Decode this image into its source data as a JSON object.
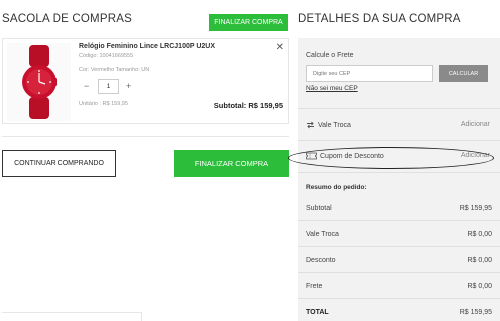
{
  "cart": {
    "title": "SACOLA DE COMPRAS",
    "finalize_top": "FINALIZAR COMPRA",
    "item": {
      "name": "Relógio Feminino Lince LRCJ100P U2UX",
      "code": "Código: 10041669555",
      "variant": "Cor: Vermelho Tamanho: UN",
      "quantity": "1",
      "unit_price": "Unitário : R$ 159,95",
      "subtotal": "Subtotal: R$ 159,95",
      "image_icon": "red-wristwatch"
    },
    "continue_label": "CONTINUAR COMPRANDO",
    "finalize_bottom": "FINALIZAR COMPRA"
  },
  "details": {
    "title": "DETALHES DA SUA COMPRA",
    "shipping_label": "Calcule o Frete",
    "cep_placeholder": "Digite seu CEP",
    "calc_label": "CALCULAR",
    "cep_link": "Não sei meu CEP",
    "vale_troca": {
      "label": "Vale Troca",
      "action": "Adicionar"
    },
    "cupom": {
      "label": "Cupom de Desconto",
      "action": "Adicionar"
    },
    "summary": {
      "heading": "Resumo do pedido:",
      "subtotal": {
        "label": "Subtotal",
        "value": "R$ 159,95"
      },
      "vale_troca": {
        "label": "Vale Troca",
        "value": "R$ 0,00"
      },
      "desconto": {
        "label": "Desconto",
        "value": "R$ 0,00"
      },
      "frete": {
        "label": "Frete",
        "value": "R$ 0,00"
      },
      "total": {
        "label": "TOTAL",
        "value": "R$ 159,95"
      }
    }
  },
  "colors": {
    "accent_green": "#2cbe3a",
    "panel_bg": "#f2f2f2",
    "calc_button": "#8a8a8a",
    "product_red": "#c8102e"
  }
}
